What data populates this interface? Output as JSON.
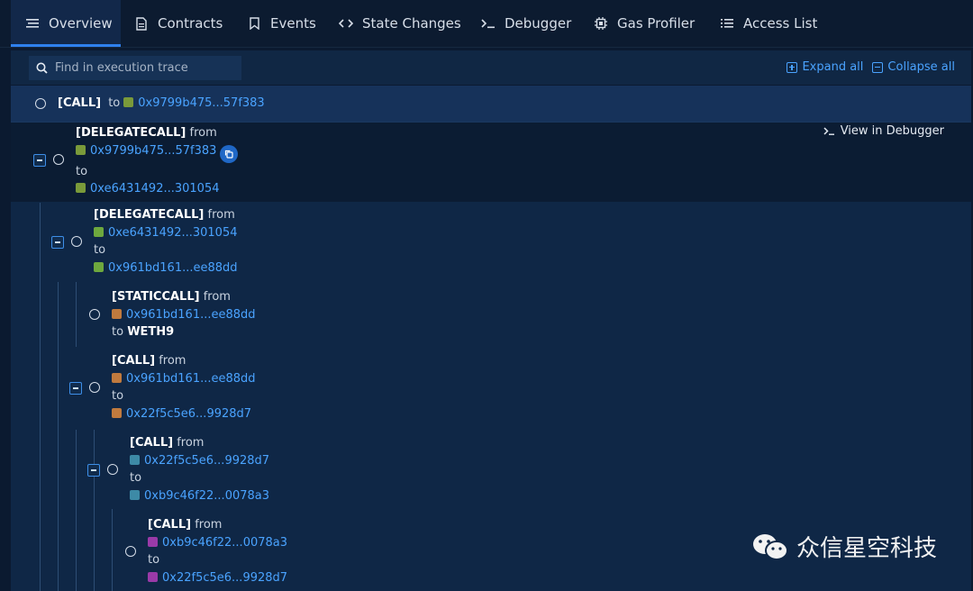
{
  "tabs": [
    {
      "label": "Overview",
      "icon": "list-icon",
      "active": true
    },
    {
      "label": "Contracts",
      "icon": "document-icon"
    },
    {
      "label": "Events",
      "icon": "bookmark-icon"
    },
    {
      "label": "State Changes",
      "icon": "code-icon"
    },
    {
      "label": "Debugger",
      "icon": "terminal-icon"
    },
    {
      "label": "Gas Profiler",
      "icon": "chip-icon"
    },
    {
      "label": "Access List",
      "icon": "list-bullets-icon"
    }
  ],
  "search": {
    "placeholder": "Find in execution trace"
  },
  "toolbar": {
    "expand_all": "Expand all",
    "collapse_all": "Collapse all"
  },
  "view_in_debugger": "View in Debugger",
  "trace": [
    {
      "kind": "[CALL]",
      "to_label": "to",
      "to": "0x9799b475...57f383",
      "to_color": "#7a9a3a"
    },
    {
      "kind": "[DELEGATECALL]",
      "from_label": "from",
      "from": "0x9799b475...57f383",
      "from_color": "#7a9a3a",
      "to_label": "to",
      "to": "0xe6431492...301054",
      "to_color": "#7a9a3a"
    },
    {
      "kind": "[DELEGATECALL]",
      "from_label": "from",
      "from": "0xe6431492...301054",
      "from_color": "#6ea83e",
      "to_label": "to",
      "to": "0x961bd161...ee88dd",
      "to_color": "#6ea83e"
    },
    {
      "kind": "[STATICCALL]",
      "from_label": "from",
      "from": "0x961bd161...ee88dd",
      "from_color": "#c07a3e",
      "to_label": "to",
      "to": "WETH9"
    },
    {
      "kind": "[CALL]",
      "from_label": "from",
      "from": "0x961bd161...ee88dd",
      "from_color": "#c07a3e",
      "to_label": "to",
      "to": "0x22f5c5e6...9928d7",
      "to_color": "#c07a3e"
    },
    {
      "kind": "[CALL]",
      "from_label": "from",
      "from": "0x22f5c5e6...9928d7",
      "from_color": "#3d8aa6",
      "to_label": "to",
      "to": "0xb9c46f22...0078a3",
      "to_color": "#3d8aa6"
    },
    {
      "kind": "[CALL]",
      "from_label": "from",
      "from": "0xb9c46f22...0078a3",
      "from_color": "#9a3aa8",
      "to_label": "to",
      "to": "0x22f5c5e6...9928d7",
      "to_color": "#9a3aa8"
    }
  ],
  "watermark": "众信星空科技"
}
